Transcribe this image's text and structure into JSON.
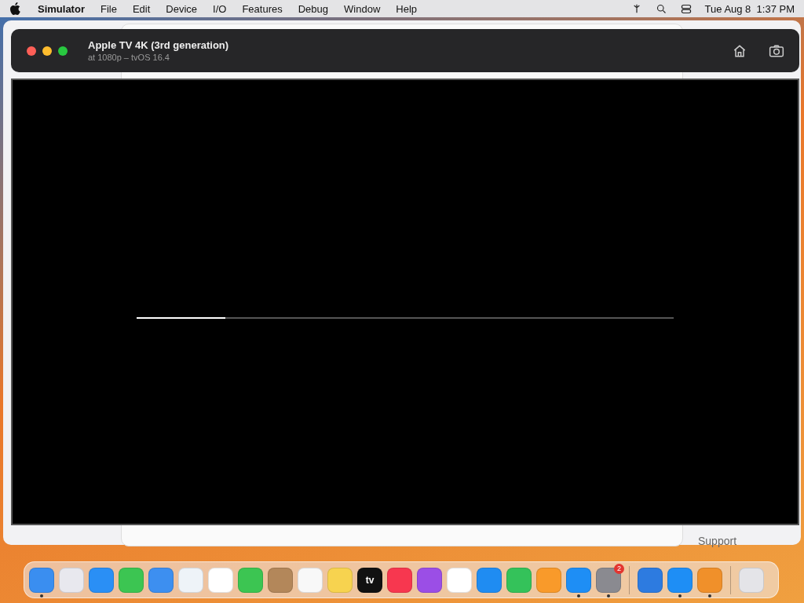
{
  "menu_bar": {
    "app": "Simulator",
    "menus": [
      "File",
      "Edit",
      "Device",
      "I/O",
      "Features",
      "Debug",
      "Window",
      "Help"
    ],
    "clock": "Tue Aug 8  1:37 PM"
  },
  "background_window": {
    "link": "Support"
  },
  "simulator": {
    "title": "Apple TV 4K (3rd generation)",
    "subtitle": "at 1080p – tvOS 16.4",
    "progress": {
      "level": 0.165
    }
  },
  "dock": {
    "apps": [
      {
        "color": "#3a8ef0",
        "running": true
      },
      {
        "color": "#e8e8ee",
        "running": false
      },
      {
        "color": "#2a8ff5",
        "running": false
      },
      {
        "color": "#3cc552",
        "running": false
      },
      {
        "color": "#3d8ff0",
        "running": false
      },
      {
        "color": "#eef3f8",
        "running": false
      },
      {
        "color": "#ffffff",
        "running": false
      },
      {
        "color": "#3cc552",
        "running": false
      },
      {
        "color": "#b3875a",
        "running": false
      },
      {
        "color": "#f8f8f8",
        "running": false
      },
      {
        "color": "#f7d34f",
        "running": false
      },
      {
        "color": "#111111",
        "running": false,
        "label": "tv"
      },
      {
        "color": "#f7374f",
        "running": false
      },
      {
        "color": "#9b4ee6",
        "running": false
      },
      {
        "color": "#ffffff",
        "running": false
      },
      {
        "color": "#1f8cf2",
        "running": false
      },
      {
        "color": "#34c25a",
        "running": false
      },
      {
        "color": "#f99a2a",
        "running": false
      },
      {
        "color": "#1e8ef5",
        "running": true
      },
      {
        "color": "#8a8a90",
        "running": true,
        "badge": "2"
      },
      {
        "kind": "divider"
      },
      {
        "color": "#2d7be0",
        "running": false
      },
      {
        "color": "#1e8ef5",
        "running": true
      },
      {
        "color": "#f0902a",
        "running": true
      },
      {
        "kind": "divider"
      },
      {
        "color": "#e4e4e8",
        "running": false
      }
    ]
  }
}
